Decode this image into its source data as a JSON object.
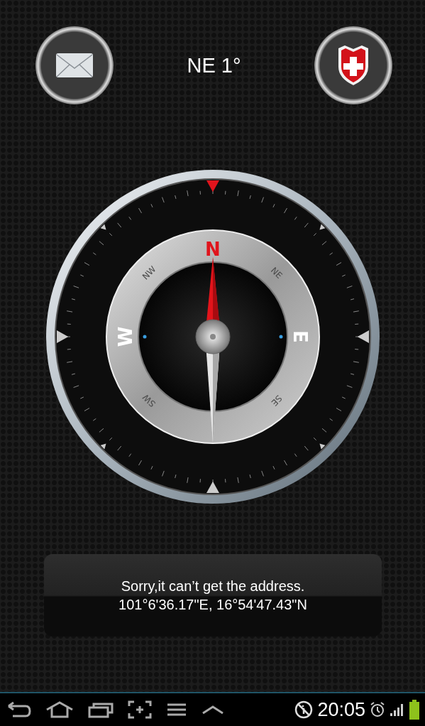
{
  "heading": "NE 1°",
  "header_buttons": [
    {
      "kind": "mail"
    },
    {
      "kind": "shield"
    }
  ],
  "compass": {
    "dial_labels": [
      {
        "text": "N"
      },
      {
        "text": "NE"
      },
      {
        "text": "E"
      },
      {
        "text": "SE"
      },
      {
        "text": "SW"
      },
      {
        "text": "W"
      },
      {
        "text": "NW"
      }
    ]
  },
  "message": {
    "lines": [
      "Sorry,it can’t get the address.",
      "101°6'36.17\"E, 16°54'47.43\"N"
    ]
  },
  "status_bar": {
    "nav": [
      {
        "kind": "back"
      },
      {
        "kind": "home"
      },
      {
        "kind": "recents"
      },
      {
        "kind": "screenshot"
      },
      {
        "kind": "menu"
      },
      {
        "kind": "up"
      }
    ],
    "time": "20:05"
  }
}
